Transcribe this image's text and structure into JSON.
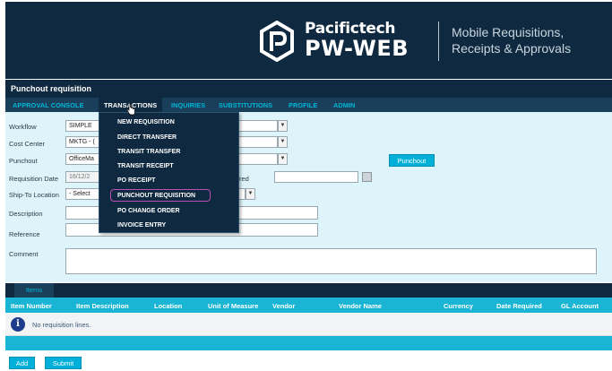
{
  "brand": {
    "company": "Pacifictech",
    "product": "PW-WEB",
    "tagline_line1": "Mobile Requisitions,",
    "tagline_line2": "Receipts & Approvals"
  },
  "page_title": "Punchout requisition",
  "menu": {
    "items": [
      "APPROVAL CONSOLE",
      "TRANSACTIONS",
      "INQUIRIES",
      "SUBSTITUTIONS",
      "PROFILE",
      "ADMIN"
    ],
    "active": "TRANSACTIONS"
  },
  "transactions_menu": [
    "NEW REQUISITION",
    "DIRECT TRANSFER",
    "TRANSIT TRANSFER",
    "TRANSIT RECEIPT",
    "PO RECEIPT",
    "PUNCHOUT REQUISITION",
    "PO CHANGE ORDER",
    "INVOICE ENTRY"
  ],
  "highlighted_menu_item": "PUNCHOUT REQUISITION",
  "form": {
    "workflow_label": "Workflow",
    "workflow_value": "SIMPLE",
    "cost_center_label": "Cost Center",
    "cost_center_value": "MKTG - (",
    "punchout_label": "Punchout",
    "punchout_value": "OfficeMa",
    "punchout_button": "Punchout",
    "requisition_date_label": "Requisition Date",
    "requisition_date_value": "16/12/2",
    "date_required_label_fragment": "red",
    "ship_to_label": "Ship-To Location",
    "ship_to_value": "- Select",
    "description_label": "Description",
    "reference_label": "Reference",
    "comment_label": "Comment"
  },
  "items": {
    "tab_label": "Items",
    "columns": [
      "Item Number",
      "Item Description",
      "Location",
      "Unit of Measure",
      "Vendor",
      "Vendor Name",
      "Currency",
      "Date Required",
      "GL Account"
    ],
    "empty_message": "No requisition lines."
  },
  "buttons": {
    "add": "Add",
    "submit": "Submit"
  },
  "colors": {
    "banner": "#0f2a40",
    "accent": "#00b0d8",
    "highlight_outline": "#b84fb3"
  }
}
